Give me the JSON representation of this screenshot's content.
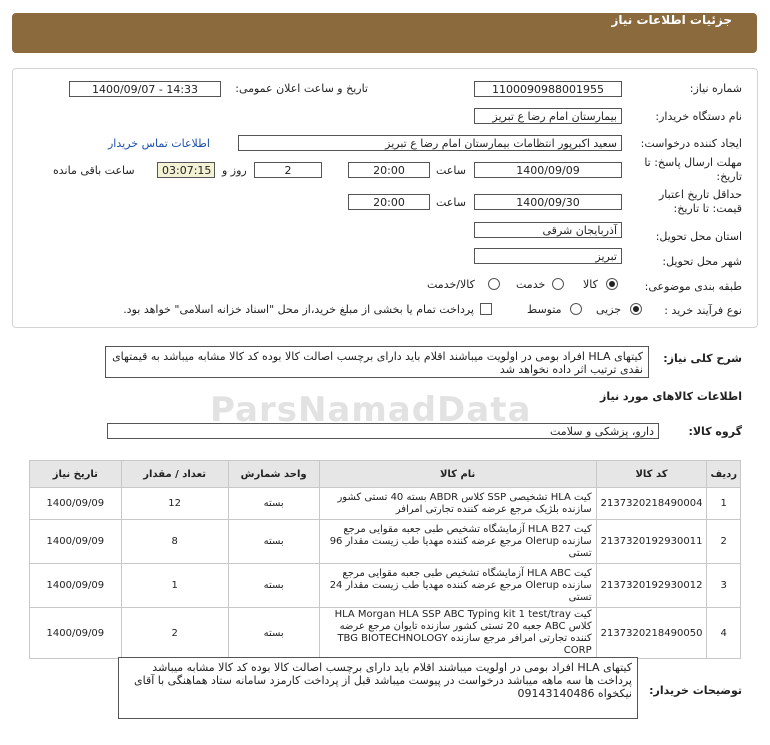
{
  "header": {
    "title": "جزئیات اطلاعات نیاز"
  },
  "watermark": "ParsNamadData",
  "form": {
    "need_number": {
      "label": "شماره نیاز:",
      "value": "1100090988001955"
    },
    "announce": {
      "label": "تاریخ و ساعت اعلان عمومی:",
      "value": "1400/09/07 - 14:33"
    },
    "buyer_org": {
      "label": "نام دستگاه خریدار:",
      "value": "بیمارستان امام رضا  ع  تبریز"
    },
    "creator": {
      "label": "ایجاد کننده درخواست:",
      "value": "سعید اکبرپور انتظامات بیمارستان امام رضا  ع  تبریز",
      "contact_link": "اطلاعات تماس خریدار"
    },
    "deadline": {
      "label_line1": "مهلت ارسال پاسخ: تا",
      "label_line2": "تاریخ:",
      "date": "1400/09/09",
      "time_label": "ساعت",
      "time": "20:00",
      "days": "2",
      "days_label": "روز و",
      "remaining": "03:07:15",
      "remaining_label": "ساعت باقی مانده"
    },
    "validity": {
      "label_line1": "حداقل تاریخ اعتبار",
      "label_line2": "قیمت: تا تاریخ:",
      "date": "1400/09/30",
      "time_label": "ساعت",
      "time": "20:00"
    },
    "province": {
      "label": "استان محل تحویل:",
      "value": "آذربایجان شرقی"
    },
    "city": {
      "label": "شهر محل تحویل:",
      "value": "تبریز"
    },
    "category": {
      "label": "طبقه بندی موضوعی:",
      "options": [
        "کالا",
        "خدمت",
        "کالا/خدمت"
      ],
      "selected": "کالا"
    },
    "purchase_type": {
      "label": "نوع فرآیند خرید :",
      "options": [
        "جزیی",
        "متوسط"
      ],
      "selected": "جزیی",
      "treasury_note": "پرداخت تمام یا بخشی از مبلغ خرید،از محل \"اسناد خزانه اسلامی\" خواهد بود."
    }
  },
  "description": {
    "label": "شرح کلی نیاز:",
    "text": "کیتهای HLA افراد بومی در اولویت میباشند اقلام باید دارای برچسب اصالت کالا بوده کد کالا مشابه میباشد به قیمتهای نقدی ترتیب اثر داده نخواهد شد"
  },
  "goods": {
    "section_title": "اطلاعات کالاهای مورد نیاز",
    "group_label": "گروه کالا:",
    "group_value": "دارو، پزشکی و سلامت",
    "columns": [
      "ردیف",
      "کد کالا",
      "نام کالا",
      "واحد شمارش",
      "تعداد / مقدار",
      "تاریخ نیاز"
    ],
    "rows": [
      {
        "idx": "1",
        "code": "2137320218490004",
        "name": "کیت HLA تشخیصی SSP کلاس ABDR بسته 40 تستی کشور سازنده بلژیک مرجع عرضه کننده تجارتی امرافر",
        "unit": "بسته",
        "qty": "12",
        "date": "1400/09/09"
      },
      {
        "idx": "2",
        "code": "2137320192930011",
        "name": "کیت HLA B27 آزمایشگاه تشخیص طبی جعبه مقوایی مرجع سازنده Olerup مرجع عرضه کننده مهدیا طب زیست مقدار 96 تستی",
        "unit": "بسته",
        "qty": "8",
        "date": "1400/09/09"
      },
      {
        "idx": "3",
        "code": "2137320192930012",
        "name": "کیت HLA ABC آزمایشگاه تشخیص طبی جعبه مقوایی مرجع سازنده Olerup مرجع عرضه کننده مهدیا طب زیست مقدار 24 تستی",
        "unit": "بسته",
        "qty": "1",
        "date": "1400/09/09"
      },
      {
        "idx": "4",
        "code": "2137320218490050",
        "name": "کیت HLA Morgan HLA SSP ABC Typing kit 1 test/tray کلاس ABC جعبه 20 تستی کشور سازنده تایوان مرجع عرضه کننده تجارتی امرافر مرجع سازنده TBG BIOTECHNOLOGY CORP",
        "unit": "بسته",
        "qty": "2",
        "date": "1400/09/09"
      }
    ]
  },
  "buyer_notes": {
    "label": "توضیحات خریدار:",
    "text": "کیتهای HLA افراد بومی در اولویت میباشند اقلام باید دارای برچسب اصالت کالا بوده کد کالا مشابه میباشد پرداخت ها سه ماهه میباشد درخواست در پیوست میباشد قبل از پرداخت کارمزد سامانه ستاد هماهنگی با  آقای  نیکخواه 09143140486"
  }
}
